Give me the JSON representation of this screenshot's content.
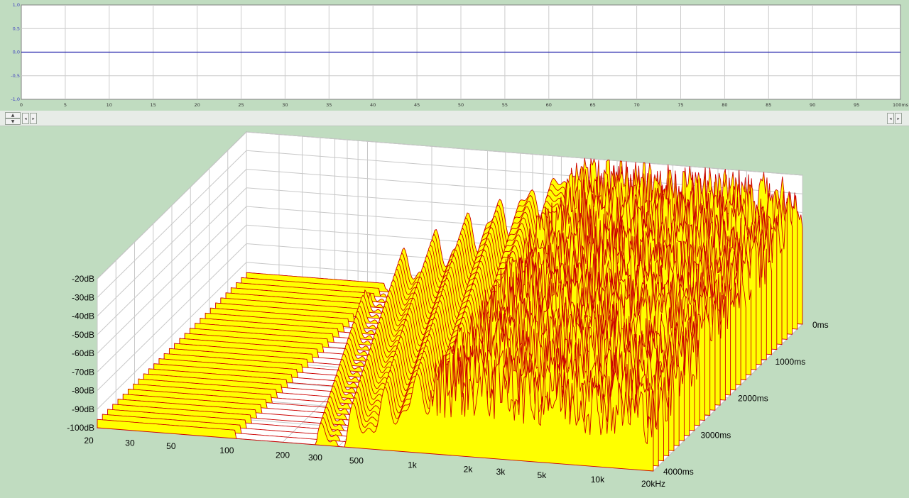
{
  "chart_data": [
    {
      "type": "line",
      "title": "",
      "xlabel": "",
      "ylabel": "",
      "xlim": [
        0,
        100
      ],
      "ylim": [
        -1.0,
        1.0
      ],
      "x_ticks": [
        "0",
        "5",
        "10",
        "15",
        "20",
        "25",
        "30",
        "35",
        "40",
        "45",
        "50",
        "55",
        "60",
        "65",
        "70",
        "75",
        "80",
        "85",
        "90",
        "95",
        "100ms"
      ],
      "y_ticks": [
        "1,0",
        "0,5",
        "0,0",
        "-0,5",
        "-1,0"
      ],
      "series": [
        {
          "x": [
            0,
            25,
            50,
            75,
            100
          ],
          "values": [
            0.0,
            0.0,
            0.0,
            0.0,
            0.0
          ]
        }
      ],
      "grid": true,
      "colors": {
        "line": "#1a1aa8",
        "grid": "#cccccc",
        "background": "#ffffff"
      }
    },
    {
      "type": "area",
      "title": "",
      "x_axis": {
        "label": "",
        "scale": "log",
        "range": [
          20,
          20000
        ],
        "ticks": [
          "20",
          "30",
          "50",
          "100",
          "200",
          "300",
          "500",
          "1k",
          "2k",
          "3k",
          "5k",
          "10k",
          "20kHz"
        ]
      },
      "y_axis": {
        "label": "",
        "range": [
          -100,
          -20
        ],
        "ticks": [
          "-20dB",
          "-30dB",
          "-40dB",
          "-50dB",
          "-60dB",
          "-70dB",
          "-80dB",
          "-90dB",
          "-100dB"
        ]
      },
      "z_axis": {
        "label": "",
        "range": [
          0,
          4000
        ],
        "ticks": [
          "0ms",
          "1000ms",
          "2000ms",
          "3000ms",
          "4000ms"
        ]
      },
      "slices": 30,
      "floor_db": -100,
      "colors": {
        "fill": "#ffff00",
        "edge": "#cc0000",
        "grid": "#c8c8c8",
        "background": "#ffffff"
      },
      "grid": true
    }
  ],
  "controls": {
    "zoom_up": "▲",
    "zoom_down": "▼",
    "scroll_left": "◂",
    "scroll_right": "▸"
  }
}
